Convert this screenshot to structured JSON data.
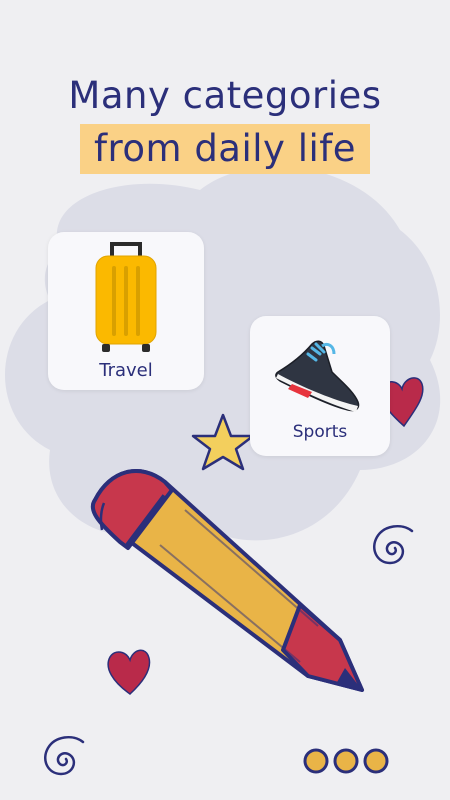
{
  "headline": {
    "line1": "Many categories",
    "line2": "from daily life"
  },
  "categories": [
    {
      "label": "Travel",
      "icon": "suitcase-icon"
    },
    {
      "label": "Sports",
      "icon": "sneaker-icon"
    }
  ],
  "colors": {
    "headline": "#2b2f7a",
    "highlight": "#fad186",
    "background": "#efeff2",
    "blob": "#dcdde7",
    "suitcase": "#fbb900",
    "pencil_body": "#e9b447",
    "pencil_eraser": "#c7374c",
    "heart": "#b92a4a",
    "star": "#f3cf5d",
    "ink": "#2b2f7a"
  },
  "pagination": {
    "dots": 3
  }
}
